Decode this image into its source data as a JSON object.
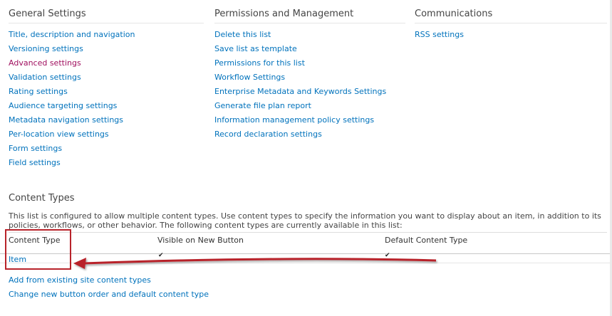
{
  "general_settings": {
    "title": "General Settings",
    "links": [
      {
        "label": "Title, description and navigation",
        "visited": false
      },
      {
        "label": "Versioning settings",
        "visited": false
      },
      {
        "label": "Advanced settings",
        "visited": true
      },
      {
        "label": "Validation settings",
        "visited": false
      },
      {
        "label": "Rating settings",
        "visited": false
      },
      {
        "label": "Audience targeting settings",
        "visited": false
      },
      {
        "label": "Metadata navigation settings",
        "visited": false
      },
      {
        "label": "Per-location view settings",
        "visited": false
      },
      {
        "label": "Form settings",
        "visited": false
      },
      {
        "label": "Field settings",
        "visited": false
      }
    ]
  },
  "permissions": {
    "title": "Permissions and Management",
    "links": [
      {
        "label": "Delete this list"
      },
      {
        "label": "Save list as template"
      },
      {
        "label": "Permissions for this list"
      },
      {
        "label": "Workflow Settings"
      },
      {
        "label": "Enterprise Metadata and Keywords Settings"
      },
      {
        "label": "Generate file plan report"
      },
      {
        "label": "Information management policy settings"
      },
      {
        "label": "Record declaration settings"
      }
    ]
  },
  "communications": {
    "title": "Communications",
    "links": [
      {
        "label": "RSS settings"
      }
    ]
  },
  "content_types": {
    "title": "Content Types",
    "description": "This list is configured to allow multiple content types. Use content types to specify the information you want to display about an item, in addition to its policies, workflows, or other behavior. The following content types are currently available in this list:",
    "columns": {
      "content_type": "Content Type",
      "visible": "Visible on New Button",
      "default": "Default Content Type"
    },
    "rows": [
      {
        "name": "Item",
        "visible_check": "✔",
        "default_check": "✔"
      }
    ],
    "actions": {
      "add_existing": "Add from existing site content types",
      "change_order": "Change new button order and default content type"
    }
  },
  "colors": {
    "link": "#0072bc",
    "visited_link": "#a0105f",
    "annotation": "#b8232a"
  },
  "icons": {
    "check": "checkmark-icon",
    "annotation_arrow": "arrow-left-icon"
  }
}
